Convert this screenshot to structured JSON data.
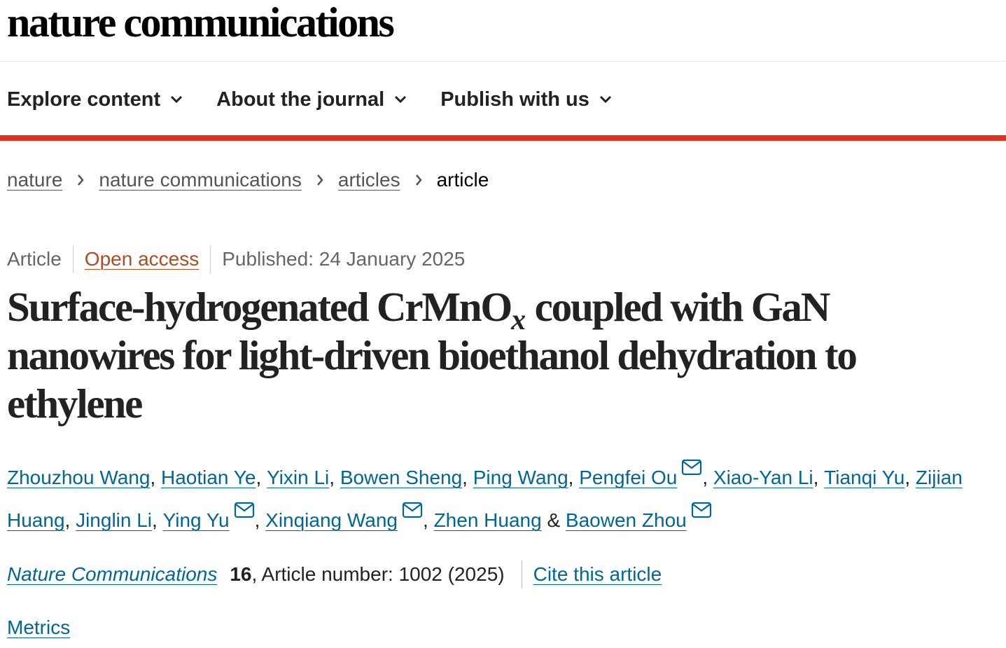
{
  "site": {
    "logo": "nature communications"
  },
  "nav": {
    "items": [
      {
        "label": "Explore content",
        "icon": "chevron-down-icon"
      },
      {
        "label": "About the journal",
        "icon": "chevron-down-icon"
      },
      {
        "label": "Publish with us",
        "icon": "chevron-down-icon"
      }
    ]
  },
  "colors": {
    "accent": "#e1301f",
    "link": "#006699",
    "open_access": "#b14b22",
    "text": "#222222",
    "muted": "#666666"
  },
  "breadcrumb": {
    "items": [
      {
        "label": "nature",
        "link": true
      },
      {
        "label": "nature communications",
        "link": true
      },
      {
        "label": "articles",
        "link": true
      },
      {
        "label": "article",
        "link": false
      }
    ],
    "separator_icon": "chevron-right-icon"
  },
  "article": {
    "type": "Article",
    "access": "Open access",
    "published": "Published: 24 January 2025",
    "title": {
      "part1": "Surface-hydrogenated CrMnO",
      "subscript": "x",
      "part2": " coupled with GaN nanowires for light-driven bioethanol dehydration to ethylene"
    },
    "authors": [
      {
        "name": "Zhouzhou Wang",
        "email": false,
        "sep": ", "
      },
      {
        "name": "Haotian Ye",
        "email": false,
        "sep": ", "
      },
      {
        "name": "Yixin Li",
        "email": false,
        "sep": ", "
      },
      {
        "name": "Bowen Sheng",
        "email": false,
        "sep": ", "
      },
      {
        "name": "Ping Wang",
        "email": false,
        "sep": ", "
      },
      {
        "name": "Pengfei Ou",
        "email": true,
        "sep": ", "
      },
      {
        "name": "Xiao-Yan Li",
        "email": false,
        "sep": ", "
      },
      {
        "name": "Tianqi Yu",
        "email": false,
        "sep": ", "
      },
      {
        "name": "Zijian Huang",
        "email": false,
        "sep": ", "
      },
      {
        "name": "Jinglin Li",
        "email": false,
        "sep": ", "
      },
      {
        "name": "Ying Yu",
        "email": true,
        "sep": ", "
      },
      {
        "name": "Xinqiang Wang",
        "email": true,
        "sep": ", "
      },
      {
        "name": "Zhen Huang",
        "email": false,
        "sep": " & "
      },
      {
        "name": "Baowen Zhou",
        "email": true,
        "sep": ""
      }
    ],
    "citation": {
      "journal": "Nature Communications",
      "volume": "16",
      "details": ", Article number: 1002 (2025)",
      "cite_label": "Cite this article"
    },
    "metrics_label": "Metrics"
  }
}
